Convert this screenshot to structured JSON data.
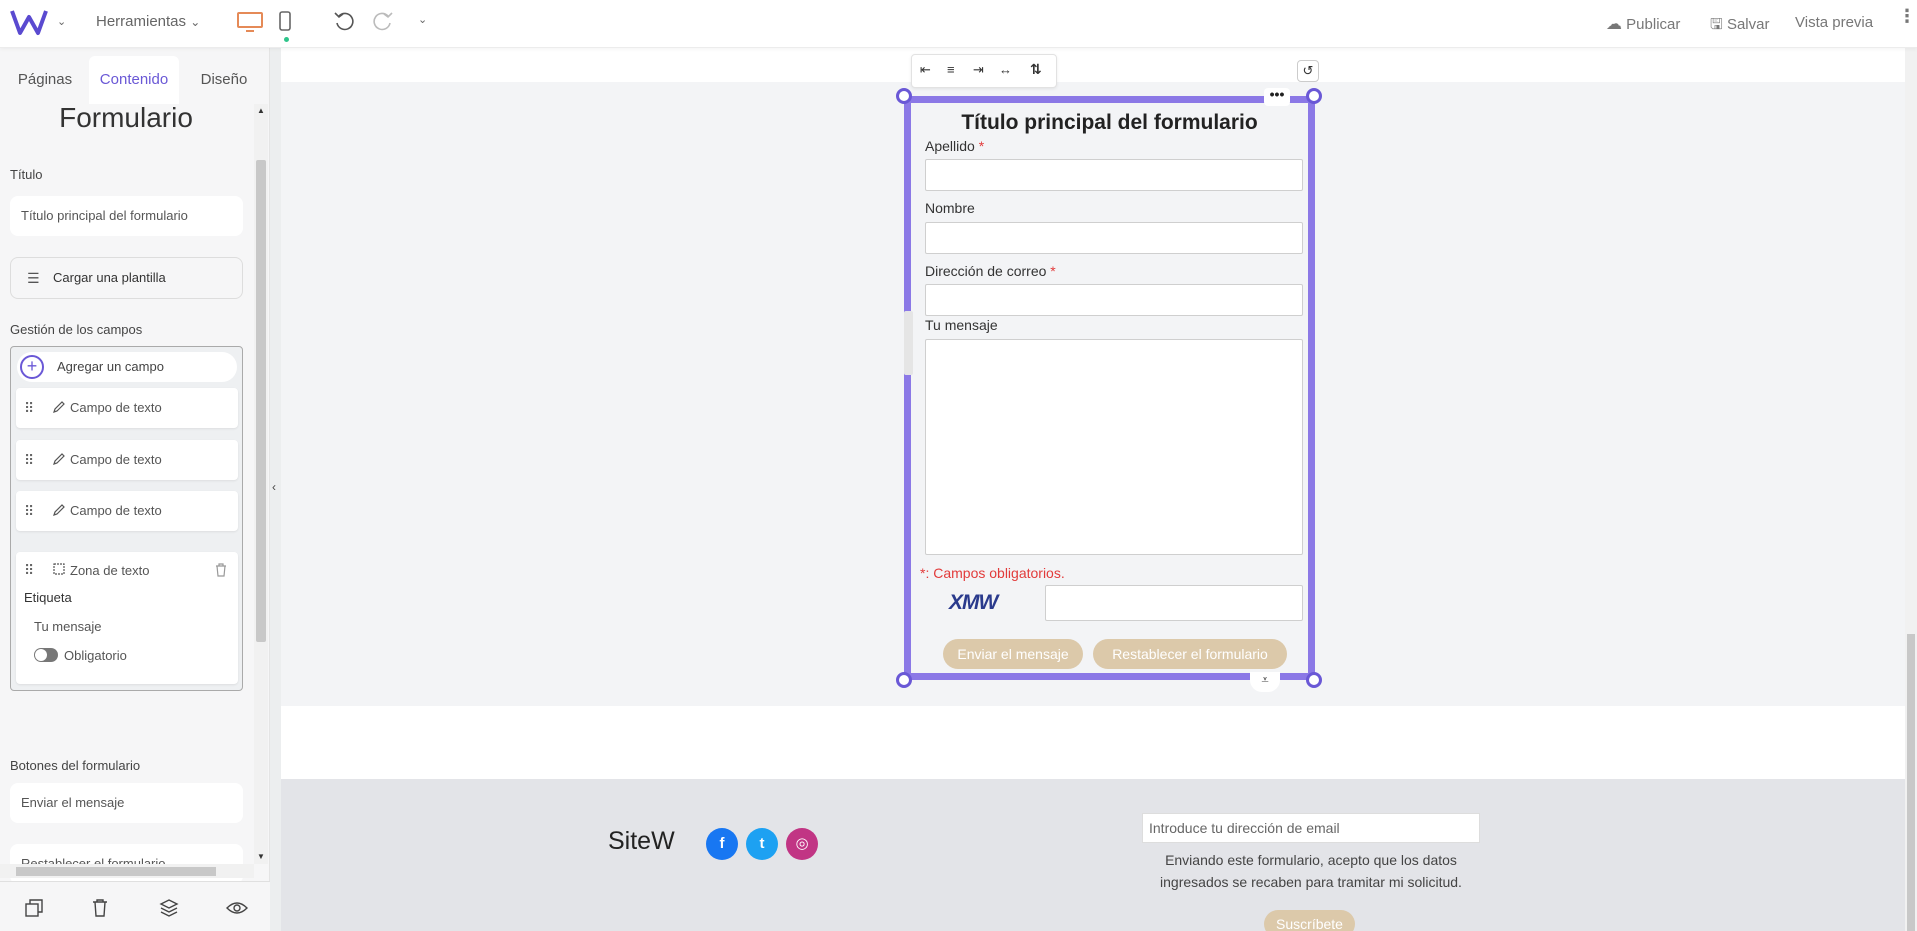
{
  "topbar": {
    "tools_label": "Herramientas",
    "publish_label": "Publicar",
    "save_label": "Salvar",
    "preview_label": "Vista previa"
  },
  "sidebar": {
    "tabs": [
      {
        "label": "Páginas"
      },
      {
        "label": "Contenido"
      },
      {
        "label": "Diseño"
      }
    ],
    "panel_title": "Formulario",
    "title_label": "Título",
    "title_value": "Título principal del formulario",
    "template_button": "Cargar una plantilla",
    "fields_label": "Gestión de los campos",
    "add_field": "Agregar un campo",
    "fields": [
      {
        "label": "Campo de texto"
      },
      {
        "label": "Campo de texto"
      },
      {
        "label": "Campo de texto"
      }
    ],
    "textarea_field": {
      "label": "Zona de texto",
      "etiqueta_label": "Etiqueta",
      "etiqueta_value": "Tu mensaje",
      "required_label": "Obligatorio"
    },
    "buttons_label": "Botones del formulario",
    "send_value": "Enviar el mensaje",
    "reset_value": "Restablecer el formulario"
  },
  "form": {
    "title": "Título principal del formulario",
    "fields": [
      {
        "label": "Apellido",
        "required": "*"
      },
      {
        "label": "Nombre",
        "required": ""
      },
      {
        "label": "Dirección de correo",
        "required": "*"
      },
      {
        "label": "Tu mensaje",
        "required": ""
      }
    ],
    "required_note": "*: Campos obligatorios.",
    "captcha": "XMW",
    "send_button": "Enviar el mensaje",
    "reset_button": "Restablecer el formulario"
  },
  "footer": {
    "brand": "SiteW",
    "email_placeholder": "Introduce tu dirección de email",
    "consent_line1": "Enviando este formulario, acepto que los datos",
    "consent_line2": "ingresados se recaben para tramitar mi solicitud.",
    "subscribe": "Suscríbete",
    "social": [
      {
        "icon": "facebook-icon",
        "glyph": "f",
        "color": "#1877f2"
      },
      {
        "icon": "twitter-icon",
        "glyph": "t",
        "color": "#1da1f2"
      },
      {
        "icon": "instagram-icon",
        "glyph": "◎",
        "color": "#c13584"
      }
    ]
  },
  "colors": {
    "accent": "#6a58d6",
    "frame": "#8b78e6",
    "button": "#dcc9aa",
    "required": "#e23b3b"
  }
}
